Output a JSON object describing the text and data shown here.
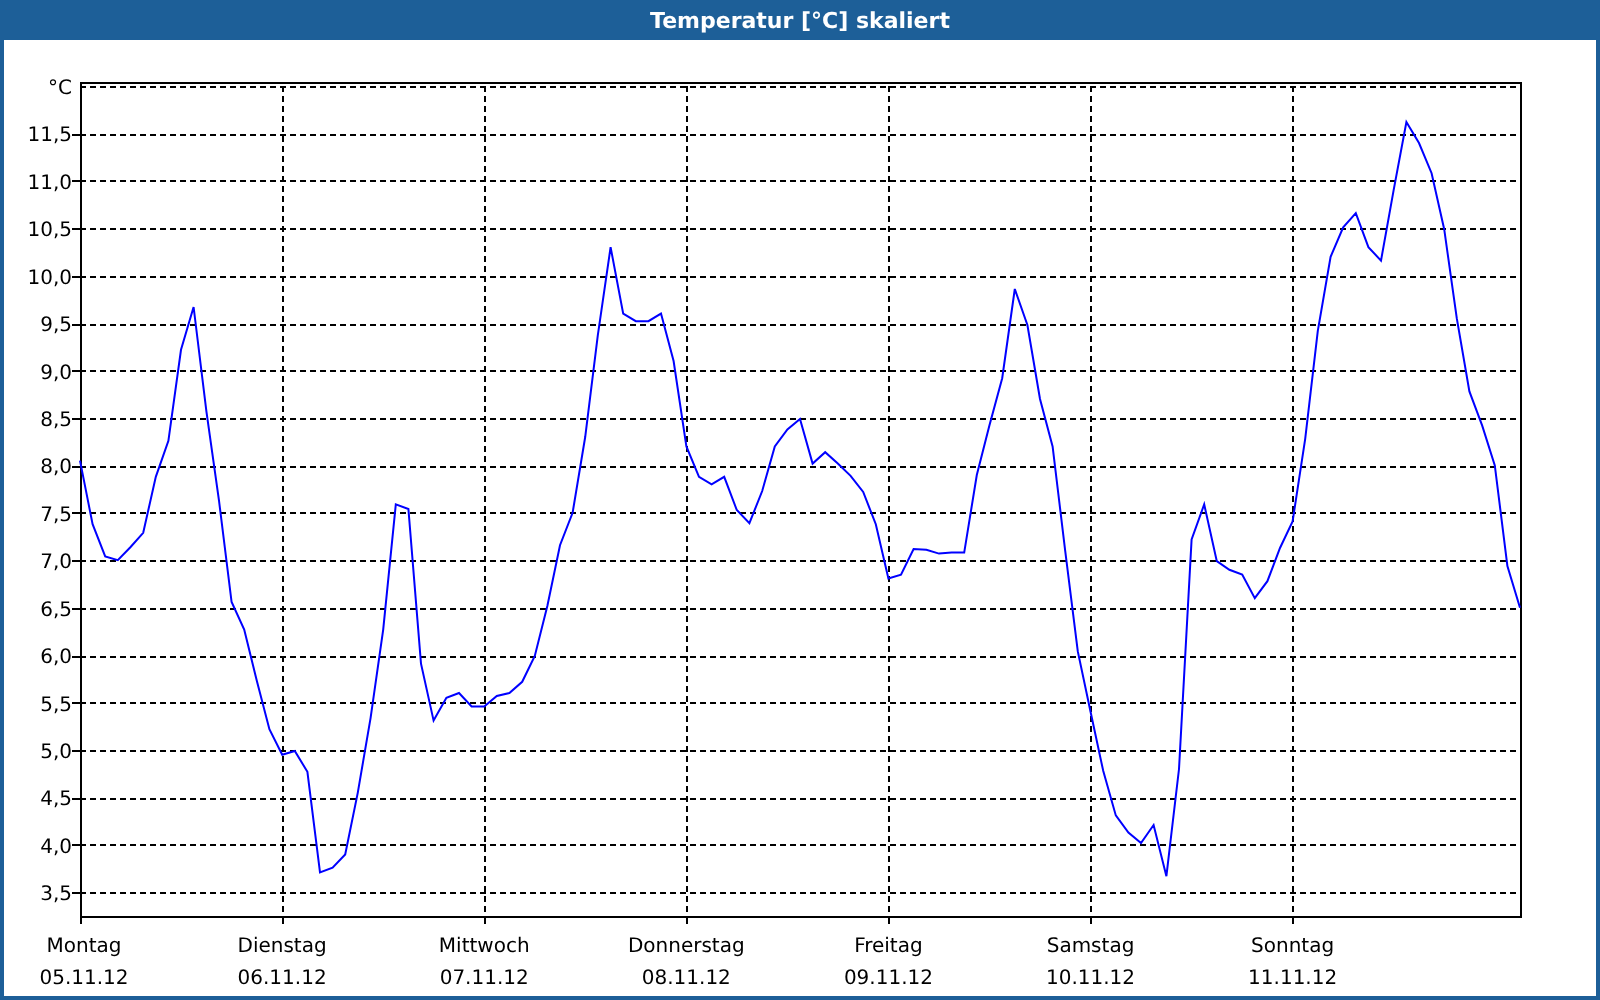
{
  "window": {
    "title": "Temperatur [°C] skaliert"
  },
  "chart": {
    "chart_data": {
      "type": "line",
      "grid": true,
      "ylabel": "°C",
      "categories": [
        "Montag 05.11.12",
        null,
        null,
        null,
        null,
        null,
        null,
        null,
        null,
        null,
        null,
        null,
        null,
        null,
        null,
        null,
        "Dienstag 06.11.12",
        null,
        null,
        null,
        null,
        null,
        null,
        null,
        null,
        null,
        null,
        null,
        null,
        null,
        null,
        null,
        "Mittwoch 07.11.12",
        null,
        null,
        null,
        null,
        null,
        null,
        null,
        null,
        null,
        null,
        null,
        null,
        null,
        null,
        null,
        "Donnerstag 08.11.12",
        null,
        null,
        null,
        null,
        null,
        null,
        null,
        null,
        null,
        null,
        null,
        null,
        null,
        null,
        null,
        "Freitag 09.11.12",
        null,
        null,
        null,
        null,
        null,
        null,
        null,
        null,
        null,
        null,
        null,
        null,
        null,
        null,
        null,
        "Samstag 10.11.12",
        null,
        null,
        null,
        null,
        null,
        null,
        null,
        null,
        null,
        null,
        null,
        null,
        null,
        null,
        null,
        "Sonntag 11.11.12",
        null,
        null,
        null,
        null,
        null,
        null,
        null,
        null,
        null,
        null,
        null,
        null,
        null,
        null,
        null,
        null,
        null,
        null
      ],
      "series": [
        {
          "color": "#0000ff",
          "values": [
            8.05,
            7.38,
            7.04,
            7.0,
            7.14,
            7.29,
            7.88,
            8.26,
            9.22,
            9.67,
            8.57,
            7.63,
            6.56,
            6.27,
            5.73,
            5.22,
            4.95,
            4.99,
            4.77,
            3.71,
            3.76,
            3.9,
            4.55,
            5.34,
            6.27,
            7.59,
            7.54,
            5.91,
            5.31,
            5.55,
            5.6,
            5.46,
            5.46,
            5.57,
            5.6,
            5.72,
            5.99,
            6.52,
            7.16,
            7.5,
            8.3,
            9.37,
            10.3,
            9.6,
            9.52,
            9.52,
            9.6,
            9.1,
            8.2,
            7.88,
            7.8,
            7.88,
            7.53,
            7.39,
            7.73,
            8.2,
            8.38,
            8.49,
            8.02,
            8.14,
            8.02,
            7.89,
            7.72,
            7.38,
            6.81,
            6.85,
            7.12,
            7.11,
            7.07,
            7.08,
            7.08,
            7.9,
            8.42,
            8.92,
            9.86,
            9.48,
            8.7,
            8.2,
            7.1,
            6.04,
            5.4,
            4.78,
            4.31,
            4.13,
            4.02,
            4.21,
            3.67,
            4.8,
            7.22,
            7.59,
            6.99,
            6.9,
            6.85,
            6.6,
            6.78,
            7.13,
            7.41,
            8.28,
            9.42,
            10.2,
            10.51,
            10.66,
            10.3,
            10.16,
            10.9,
            11.62,
            11.4,
            11.08,
            10.49,
            9.55,
            8.78,
            8.42,
            8.0,
            6.94,
            6.5
          ]
        }
      ],
      "ylim": [
        3.25,
        12.0
      ],
      "yticks": [
        {
          "value": 3.5,
          "label": "3,5"
        },
        {
          "value": 4.0,
          "label": "4,0"
        },
        {
          "value": 4.5,
          "label": "4,5"
        },
        {
          "value": 5.0,
          "label": "5,0"
        },
        {
          "value": 5.5,
          "label": "5,5"
        },
        {
          "value": 6.0,
          "label": "6,0"
        },
        {
          "value": 6.5,
          "label": "6,5"
        },
        {
          "value": 7.0,
          "label": "7,0"
        },
        {
          "value": 7.5,
          "label": "7,5"
        },
        {
          "value": 8.0,
          "label": "8,0"
        },
        {
          "value": 8.5,
          "label": "8,5"
        },
        {
          "value": 9.0,
          "label": "9,0"
        },
        {
          "value": 9.5,
          "label": "9,5"
        },
        {
          "value": 10.0,
          "label": "10,0"
        },
        {
          "value": 10.5,
          "label": "10,5"
        },
        {
          "value": 11.0,
          "label": "11,0"
        },
        {
          "value": 11.5,
          "label": "11,5"
        }
      ]
    }
  }
}
